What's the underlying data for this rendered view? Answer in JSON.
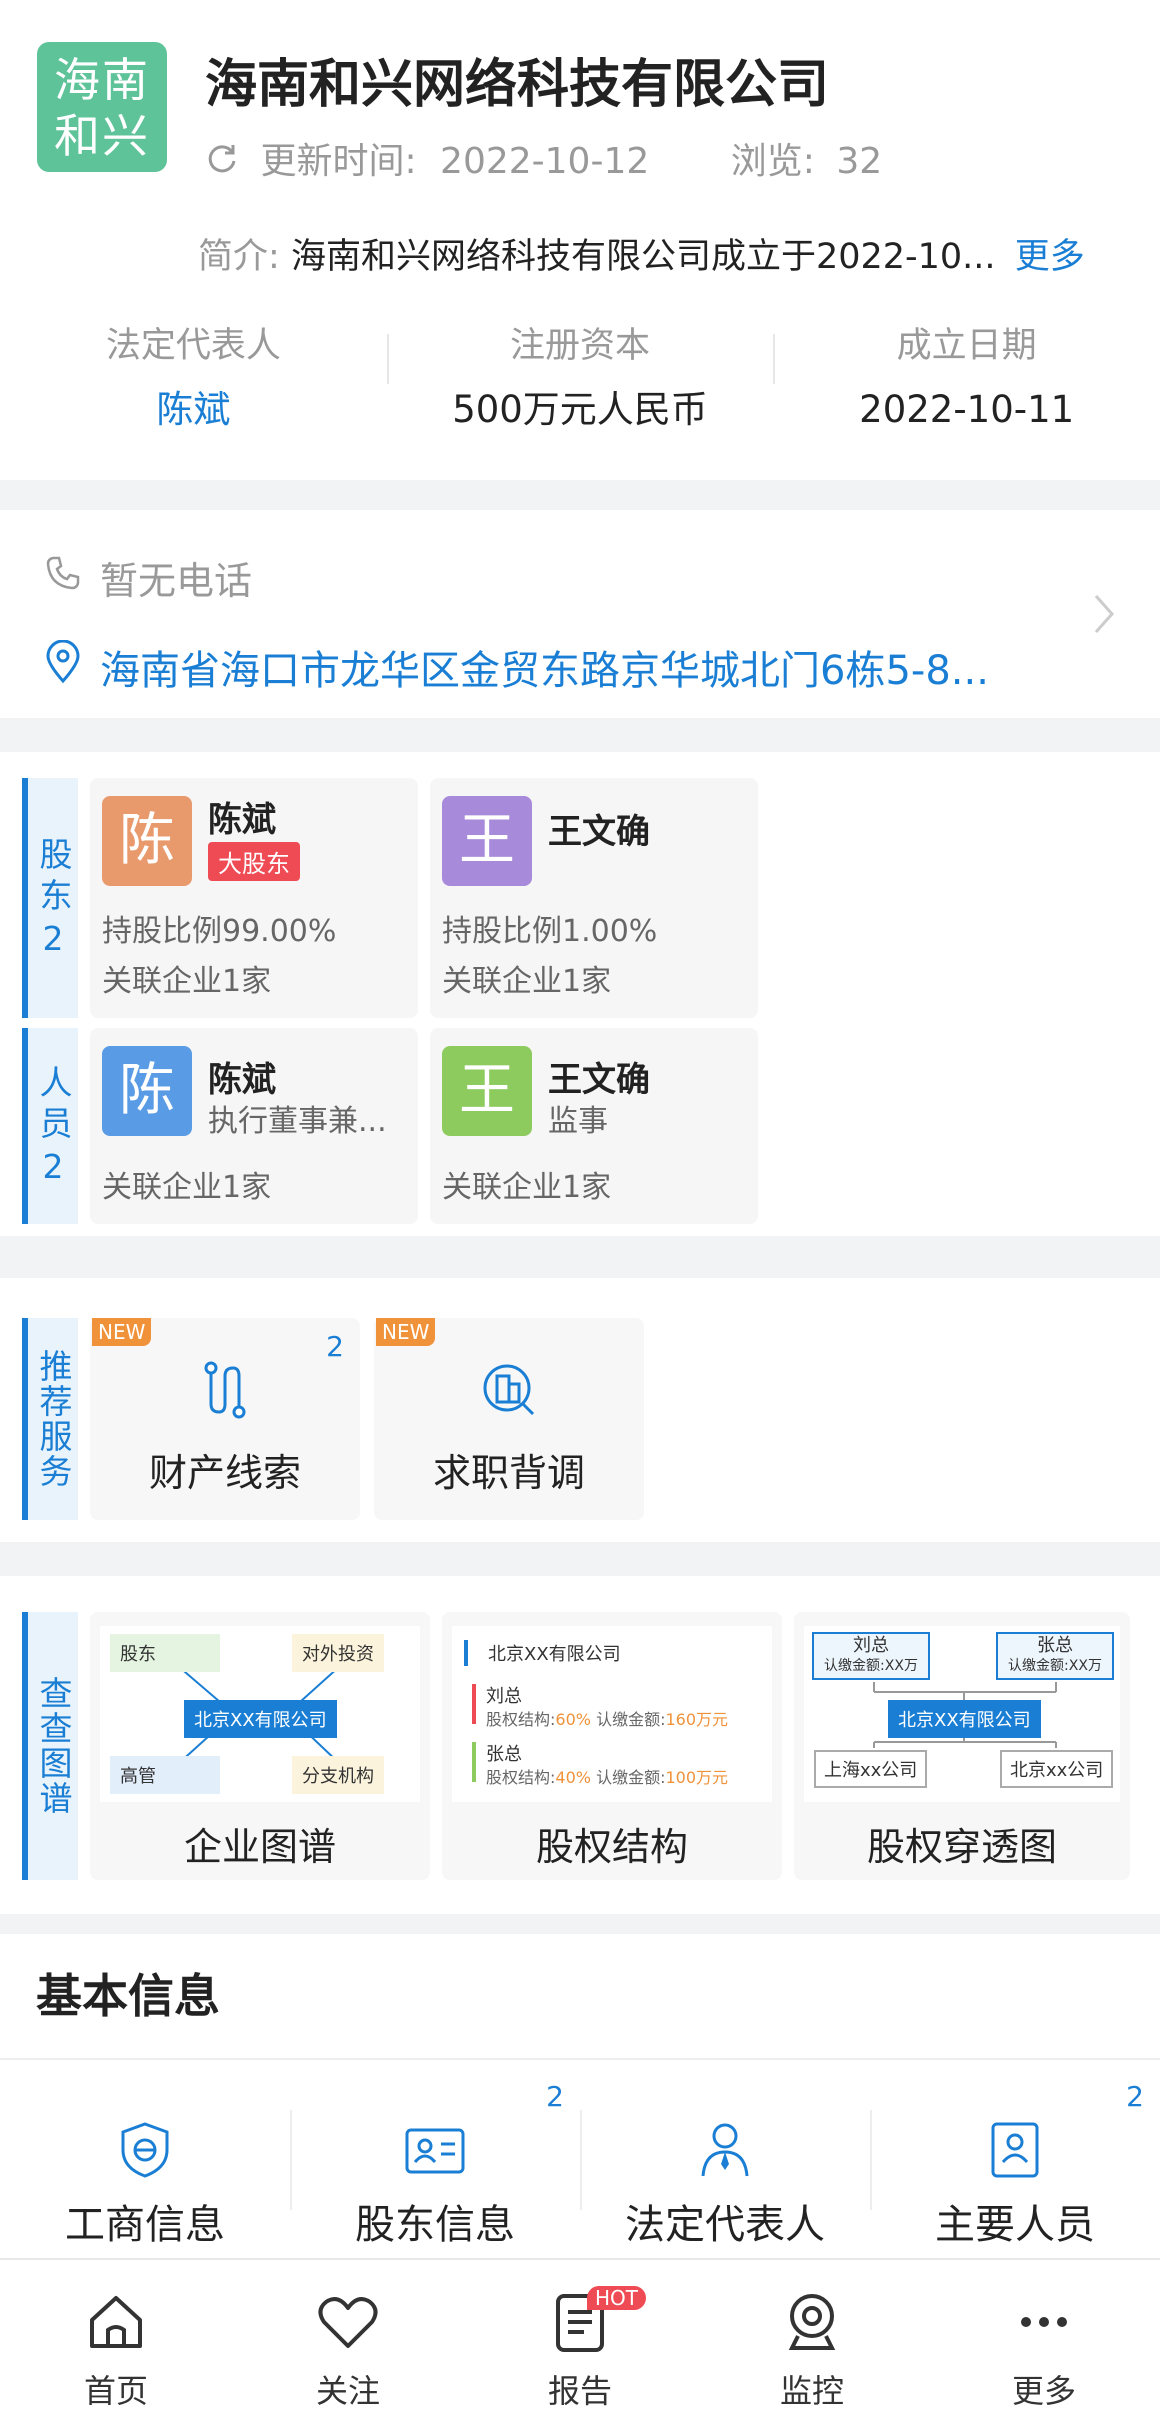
{
  "header": {
    "logo_text": "海南和兴",
    "company_name": "海南和兴网络科技有限公司",
    "updated_label": "更新时间:",
    "updated_value": "2022-10-12",
    "views_label": "浏览:",
    "views_value": "32",
    "intro_label": "简介:",
    "intro_text": "海南和兴网络科技有限公司成立于2022-10...",
    "more_link": "更多",
    "stats": [
      {
        "label": "法定代表人",
        "value": "陈斌"
      },
      {
        "label": "注册资本",
        "value": "500万元人民币"
      },
      {
        "label": "成立日期",
        "value": "2022-10-11"
      }
    ]
  },
  "contact": {
    "phone": "暂无电话",
    "address": "海南省海口市龙华区金贸东路京华城北门6栋5-8..."
  },
  "shareholders": {
    "tab_label": "股东",
    "tab_count": "2",
    "items": [
      {
        "avatar": "陈",
        "name": "陈斌",
        "badge": "大股东",
        "ratio": "持股比例99.00%",
        "related": "关联企业1家",
        "color": "#e99a6d"
      },
      {
        "avatar": "王",
        "name": "王文确",
        "ratio": "持股比例1.00%",
        "related": "关联企业1家",
        "color": "#a78ad9"
      }
    ]
  },
  "staff": {
    "tab_label": "人员",
    "tab_count": "2",
    "items": [
      {
        "avatar": "陈",
        "name": "陈斌",
        "role": "执行董事兼...",
        "related": "关联企业1家",
        "color": "#5a9be6"
      },
      {
        "avatar": "王",
        "name": "王文确",
        "role": "监事",
        "related": "关联企业1家",
        "color": "#8dcb5e"
      }
    ]
  },
  "services": {
    "tab_label": "推荐服务",
    "items": [
      {
        "badge": "NEW",
        "count": "2",
        "label": "财产线索",
        "icon": "property-clue-icon"
      },
      {
        "badge": "NEW",
        "count": "",
        "label": "求职背调",
        "icon": "job-background-icon"
      }
    ]
  },
  "maps": {
    "tab_label": "查查图谱",
    "items": [
      {
        "label": "企业图谱",
        "nodes": {
          "tl": "股东",
          "tr": "对外投资",
          "center": "北京XX有限公司",
          "bl": "高管",
          "br": "分支机构"
        }
      },
      {
        "label": "股权结构",
        "root": "北京XX有限公司",
        "rows": [
          {
            "name": "刘总",
            "ratio_label": "股权结构:",
            "ratio": "60%",
            "amount_label": "认缴金额:",
            "amount": "160万元"
          },
          {
            "name": "张总",
            "ratio_label": "股权结构:",
            "ratio": "40%",
            "amount_label": "认缴金额:",
            "amount": "100万元"
          }
        ]
      },
      {
        "label": "股权穿透图",
        "top_left": {
          "name": "刘总",
          "sub": "认缴金额:XX万"
        },
        "top_right": {
          "name": "张总",
          "sub": "认缴金额:XX万"
        },
        "center": "北京XX有限公司",
        "bottom_left": "上海xx公司",
        "bottom_right": "北京xx公司"
      }
    ]
  },
  "basic_info": {
    "title": "基本信息",
    "items": [
      {
        "label": "工商信息",
        "count": "",
        "icon": "business-info-icon"
      },
      {
        "label": "股东信息",
        "count": "2",
        "icon": "shareholder-info-icon"
      },
      {
        "label": "法定代表人",
        "count": "",
        "icon": "legal-rep-icon"
      },
      {
        "label": "主要人员",
        "count": "2",
        "icon": "key-staff-icon"
      }
    ]
  },
  "tabbar": {
    "items": [
      {
        "label": "首页",
        "icon": "home-icon"
      },
      {
        "label": "关注",
        "icon": "heart-icon"
      },
      {
        "label": "报告",
        "icon": "report-icon",
        "badge": "HOT"
      },
      {
        "label": "监控",
        "icon": "monitor-icon"
      },
      {
        "label": "更多",
        "icon": "more-icon"
      }
    ]
  }
}
